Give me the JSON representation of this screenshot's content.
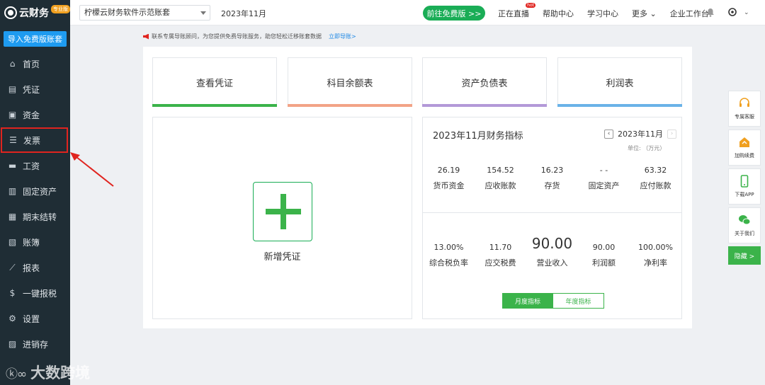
{
  "sidebar": {
    "logo_text": "云财务",
    "logo_badge": "专业版",
    "import_label": "导入免费版账套",
    "items": [
      {
        "label": "首页",
        "icon": "home-icon",
        "glyph": "⌂"
      },
      {
        "label": "凭证",
        "icon": "voucher-icon",
        "glyph": "▤"
      },
      {
        "label": "资金",
        "icon": "funds-icon",
        "glyph": "▣"
      },
      {
        "label": "发票",
        "icon": "invoice-icon",
        "glyph": "☰"
      },
      {
        "label": "工资",
        "icon": "salary-icon",
        "glyph": "▬"
      },
      {
        "label": "固定资产",
        "icon": "fixed-asset-icon",
        "glyph": "▥"
      },
      {
        "label": "期末结转",
        "icon": "period-close-icon",
        "glyph": "▦"
      },
      {
        "label": "账簿",
        "icon": "ledger-icon",
        "glyph": "▧"
      },
      {
        "label": "报表",
        "icon": "report-icon",
        "glyph": "⟋"
      },
      {
        "label": "一键报税",
        "icon": "tax-filing-icon",
        "glyph": "$"
      },
      {
        "label": "设置",
        "icon": "settings-icon",
        "glyph": "⚙"
      },
      {
        "label": "进销存",
        "icon": "inventory-icon",
        "glyph": "▨"
      }
    ]
  },
  "topbar": {
    "account_name": "柠檬云财务软件示范账套",
    "period": "2023年11月",
    "free_button": "前往免费版 >>",
    "links": [
      {
        "label": "正在直播",
        "badge": "hot"
      },
      {
        "label": "帮助中心"
      },
      {
        "label": "学习中心"
      },
      {
        "label": "更多 ⌄"
      },
      {
        "label": "企业工作台"
      }
    ]
  },
  "notice": {
    "text": "联系专属导账顾问，为您提供免费导账服务，助您轻松迁移账套数据",
    "link": "立即导账>"
  },
  "quick_cards": [
    {
      "label": "查看凭证",
      "color": "#3bb34a"
    },
    {
      "label": "科目余额表",
      "color": "#f2a387"
    },
    {
      "label": "资产负债表",
      "color": "#b399d8"
    },
    {
      "label": "利润表",
      "color": "#6ab2e8"
    }
  ],
  "add_voucher": {
    "label": "新增凭证"
  },
  "financial": {
    "title": "2023年11月财务指标",
    "period": "2023年11月",
    "unit": "单位: （万元）",
    "row1": [
      {
        "value": "26.19",
        "label": "货币资金"
      },
      {
        "value": "154.52",
        "label": "应收账款"
      },
      {
        "value": "16.23",
        "label": "存货"
      },
      {
        "value": "- -",
        "label": "固定资产"
      },
      {
        "value": "63.32",
        "label": "应付账款"
      }
    ],
    "row2": [
      {
        "value": "13.00%",
        "label": "综合税负率"
      },
      {
        "value": "11.70",
        "label": "应交税费"
      },
      {
        "value": "90.00",
        "label": "营业收入"
      },
      {
        "value": "90.00",
        "label": "利润额"
      },
      {
        "value": "100.00%",
        "label": "净利率"
      }
    ],
    "tab_monthly": "月度指标",
    "tab_yearly": "年度指标"
  },
  "right_panel": {
    "items": [
      {
        "label": "专属客服"
      },
      {
        "label": "加购续费"
      },
      {
        "label": "下载APP"
      },
      {
        "label": "关于我们"
      }
    ],
    "hide_label": "隐藏 >"
  },
  "watermark": {
    "mark": "ⓚ∞",
    "text": "大数跨境"
  },
  "colors": {
    "sidebar": "#1f2d35",
    "accent_green": "#3bb34a",
    "primary_blue": "#1e9bf0",
    "highlight_red": "#e0241f"
  }
}
